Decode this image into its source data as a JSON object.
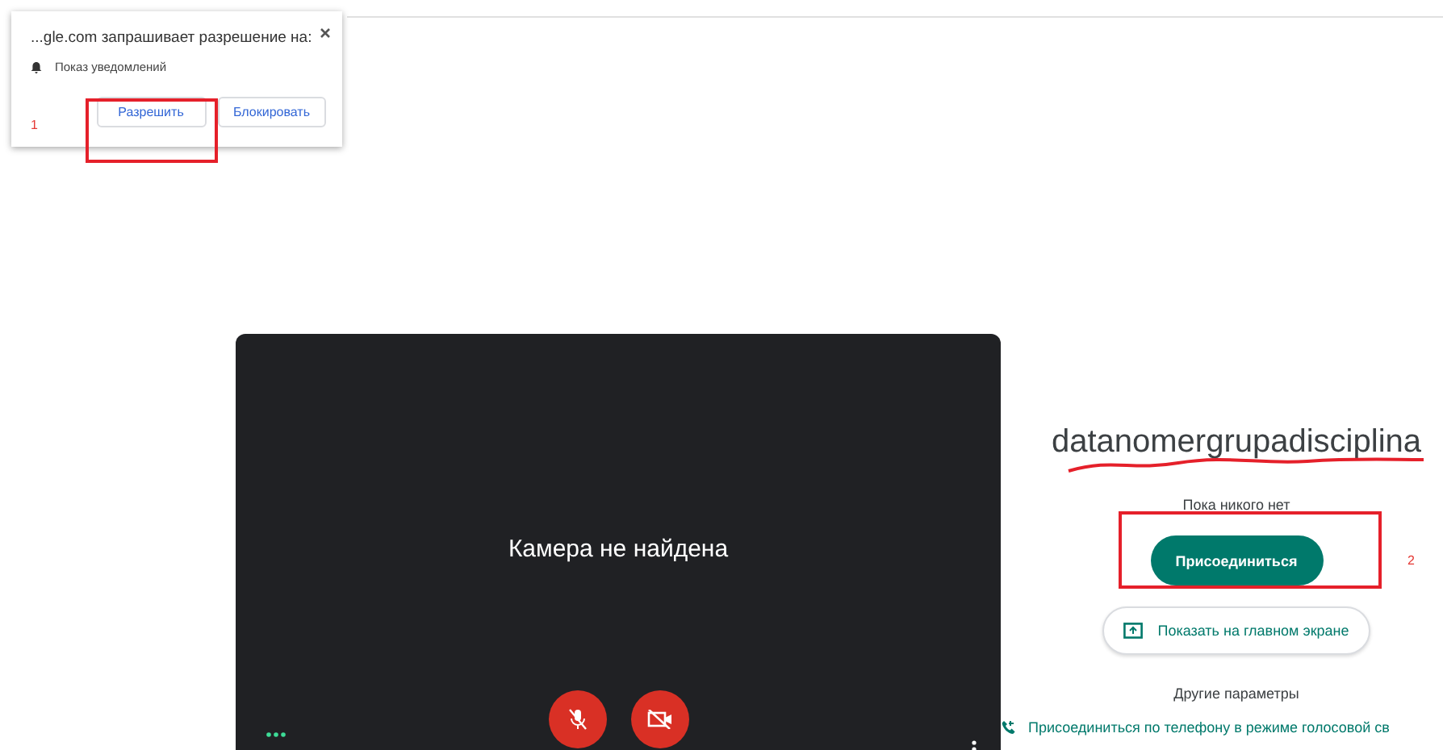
{
  "permission_popup": {
    "message": "...gle.com запрашивает разрешение на:",
    "permission": "Показ уведомлений",
    "buttons": [
      {
        "label": "Разрешить",
        "kind": "allow"
      },
      {
        "label": "Блокировать",
        "kind": "block"
      }
    ]
  },
  "annotations": [
    {
      "label": "1"
    },
    {
      "label": "2"
    }
  ],
  "video_preview": {
    "message": "Камера не найдена",
    "microphone": {
      "on": false
    },
    "camera": {
      "on": false
    }
  },
  "meeting": {
    "title": "datanomergrupadisciplina",
    "status": "Пока никого нет",
    "join_button": "Присоединиться",
    "present_button": "Показать на главном экране",
    "other_options": "Другие параметры",
    "phone_link": "Присоединиться по телефону в режиме голосовой св"
  }
}
